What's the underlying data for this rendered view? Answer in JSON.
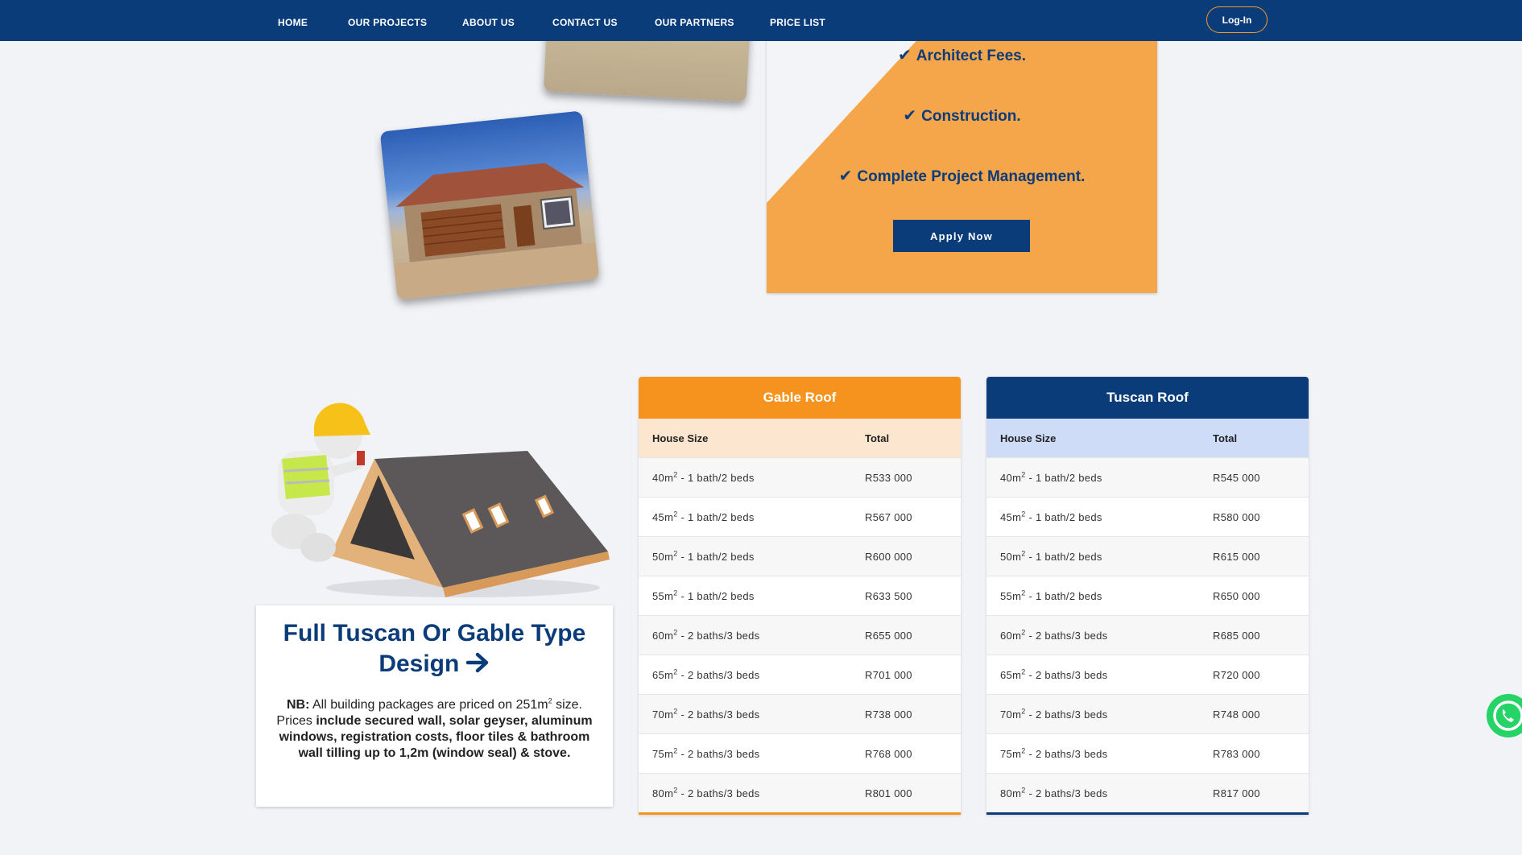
{
  "nav": {
    "items": [
      "HOME",
      "OUR PROJECTS",
      "ABOUT US",
      "CONTACT US",
      "OUR PARTNERS",
      "PRICE LIST"
    ],
    "login_label": "Log-In"
  },
  "promo": {
    "lines": [
      "Architect Fees.",
      "Construction.",
      "Complete Project Management."
    ],
    "apply_label": "Apply Now"
  },
  "info": {
    "title": "Full Tuscan Or Gable Type Design",
    "nb_label": "NB:",
    "nb_text_1": "All building packages are priced on 251m",
    "nb_sup": "2",
    "nb_text_2": "size.",
    "prices_text": "Prices",
    "prices_bold": "include secured wall, solar geyser, aluminum windows, registration costs, floor tiles & bathroom wall tilling up to 1,2m (window seal) & stove."
  },
  "gable": {
    "title": "Gable Roof",
    "col_size": "House Size",
    "col_total": "Total",
    "rows": [
      {
        "size": "40",
        "desc": "- 1 bath/2 beds",
        "total": "R533 000"
      },
      {
        "size": "45",
        "desc": "- 1 bath/2 beds",
        "total": "R567 000"
      },
      {
        "size": "50",
        "desc": "- 1 bath/2 beds",
        "total": "R600 000"
      },
      {
        "size": "55",
        "desc": "- 1 bath/2 beds",
        "total": "R633 500"
      },
      {
        "size": "60",
        "desc": "- 2 baths/3 beds",
        "total": "R655 000"
      },
      {
        "size": "65",
        "desc": "- 2 baths/3 beds",
        "total": "R701 000"
      },
      {
        "size": "70",
        "desc": "- 2 baths/3 beds",
        "total": "R738 000"
      },
      {
        "size": "75",
        "desc": "- 2 baths/3 beds",
        "total": "R768 000"
      },
      {
        "size": "80",
        "desc": "- 2 baths/3 beds",
        "total": "R801 000"
      }
    ]
  },
  "tuscan": {
    "title": "Tuscan Roof",
    "col_size": "House Size",
    "col_total": "Total",
    "rows": [
      {
        "size": "40",
        "desc": "- 1 bath/2 beds",
        "total": "R545 000"
      },
      {
        "size": "45",
        "desc": "- 1 bath/2 beds",
        "total": "R580 000"
      },
      {
        "size": "50",
        "desc": "- 1 bath/2 beds",
        "total": "R615 000"
      },
      {
        "size": "55",
        "desc": "- 1 bath/2 beds",
        "total": "R650 000"
      },
      {
        "size": "60",
        "desc": "- 2 baths/3 beds",
        "total": "R685 000"
      },
      {
        "size": "65",
        "desc": "- 2 baths/3 beds",
        "total": "R720 000"
      },
      {
        "size": "70",
        "desc": "- 2 baths/3 beds",
        "total": "R748 000"
      },
      {
        "size": "75",
        "desc": "- 2 baths/3 beds",
        "total": "R783 000"
      },
      {
        "size": "80",
        "desc": "- 2 baths/3 beds",
        "total": "R817 000"
      }
    ]
  },
  "unit": "m",
  "unit_sup": "2",
  "colors": {
    "navy": "#0b3c7a",
    "orange": "#f5931e",
    "promo_orange": "#f5a64a",
    "whatsapp": "#25d366"
  },
  "icons": [
    "check-icon",
    "arrow-right-icon",
    "whatsapp-icon"
  ]
}
